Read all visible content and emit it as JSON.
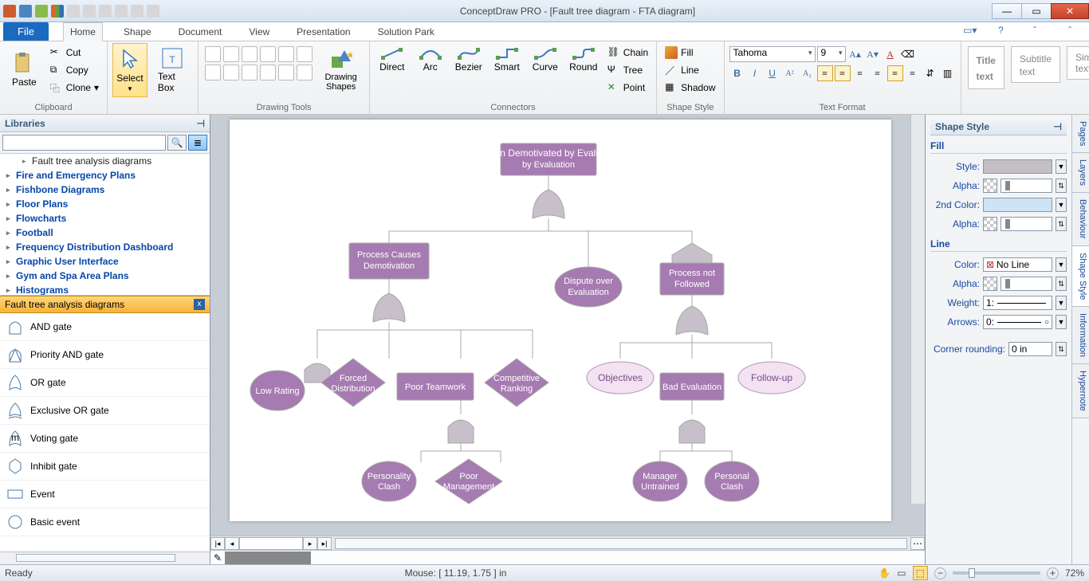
{
  "titlebar": {
    "title": "ConceptDraw PRO - [Fault tree diagram - FTA diagram]"
  },
  "tabs": {
    "file": "File",
    "home": "Home",
    "shape": "Shape",
    "document": "Document",
    "view": "View",
    "presentation": "Presentation",
    "solution": "Solution Park"
  },
  "ribbon": {
    "clipboard": {
      "paste": "Paste",
      "cut": "Cut",
      "copy": "Copy",
      "clone": "Clone",
      "label": "Clipboard"
    },
    "select": "Select",
    "textbox": "Text Box",
    "drawingshapes": "Drawing Shapes",
    "drawingtools": "Drawing Tools",
    "connectors": {
      "direct": "Direct",
      "arc": "Arc",
      "bezier": "Bezier",
      "smart": "Smart",
      "curve": "Curve",
      "round": "Round",
      "chain": "Chain",
      "tree": "Tree",
      "point": "Point",
      "label": "Connectors"
    },
    "shapestyle": {
      "fill": "Fill",
      "line": "Line",
      "shadow": "Shadow",
      "label": "Shape Style"
    },
    "textformat": {
      "font": "Tahoma",
      "size": "9",
      "label": "Text Format"
    },
    "styles": {
      "title": "Title text",
      "subtitle": "Subtitle text",
      "simple": "Simple text"
    }
  },
  "libraries": {
    "title": "Libraries",
    "tree": [
      "Fault tree analysis diagrams",
      "Fire and Emergency Plans",
      "Fishbone Diagrams",
      "Floor Plans",
      "Flowcharts",
      "Football",
      "Frequency Distribution Dashboard",
      "Graphic User Interface",
      "Gym and Spa Area Plans",
      "Histograms"
    ],
    "section": "Fault tree analysis diagrams",
    "items": [
      "AND gate",
      "Priority AND gate",
      "OR gate",
      "Exclusive OR gate",
      "Voting gate",
      "Inhibit gate",
      "Event",
      "Basic event"
    ]
  },
  "diagram": {
    "n1": "Person Demotivated by Evaluation",
    "n2": "Process Causes Demotivation",
    "n3": "Dispute over Evaluation",
    "n4": "Process not Followed",
    "n5": "Low Rating",
    "n6": "Forced Distribution",
    "n7": "Poor Teamwork",
    "n8": "Competitive Ranking",
    "n9": "Objectives",
    "n10": "Bad Evaluation",
    "n11": "Follow-up",
    "n12": "Personality Clash",
    "n13": "Poor Management",
    "n14": "Manager Untrained",
    "n15": "Personal Clash"
  },
  "shapestyle_panel": {
    "title": "Shape Style",
    "fill": "Fill",
    "style": "Style:",
    "alpha": "Alpha:",
    "second": "2nd Color:",
    "line": "Line",
    "color": "Color:",
    "noline": "No Line",
    "weight": "Weight:",
    "weightval": "1:",
    "arrows": "Arrows:",
    "arrowsval": "0:",
    "rounding": "Corner rounding:",
    "roundval": "0 in"
  },
  "rtabs": [
    "Pages",
    "Layers",
    "Behaviour",
    "Shape Style",
    "Information",
    "Hypernote"
  ],
  "statusbar": {
    "ready": "Ready",
    "mouse": "Mouse: [ 11.19, 1.75 ] in",
    "zoom": "72%"
  },
  "swatches": [
    "#ffc0cb",
    "#ffb0b0",
    "#ffd0a0",
    "#ffe0a0",
    "#fff0a0",
    "#ffffa0",
    "#e8f8a0",
    "#c0f0a0",
    "#a0e8c0",
    "#a0e0e0",
    "#a0d0f0",
    "#a0c0f8",
    "#c0c0f8",
    "#e0c0f8",
    "#f0c0e8",
    "#ff0000",
    "#ff8000",
    "#ffc000",
    "#ffff00",
    "#c0ff00",
    "#80ff00",
    "#00ff00",
    "#00ff80",
    "#00ffff",
    "#00c0ff",
    "#0080ff",
    "#0000ff",
    "#8000ff",
    "#c000ff",
    "#ff00ff",
    "#804040",
    "#a05030",
    "#606030",
    "#306030",
    "#305050",
    "#304060",
    "#403060",
    "#603050",
    "#008080",
    "#006060",
    "#2a6060",
    "#2a4a80",
    "#4a2a80",
    "#6a2a6a",
    "#802a50",
    "#90a0d0",
    "#a0b0e0",
    "#b0c0e8",
    "#c0d0f0",
    "#d0e0f8",
    "#e0c0f0",
    "#f0d0f8",
    "#ffb0e0",
    "#ff90c0"
  ]
}
